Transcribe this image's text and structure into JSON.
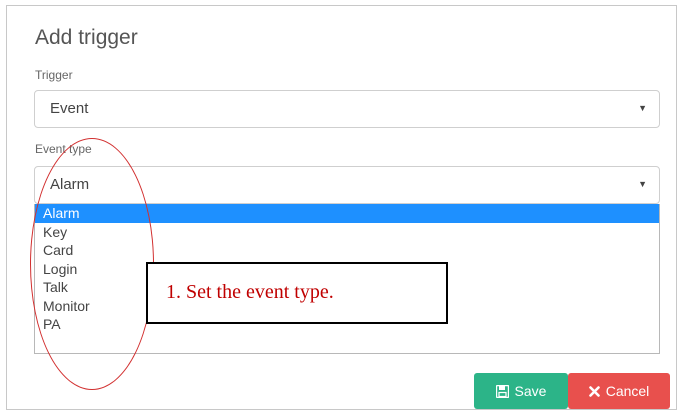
{
  "dialog": {
    "title": "Add trigger"
  },
  "trigger_field": {
    "label": "Trigger",
    "value": "Event"
  },
  "event_type_field": {
    "label": "Event type",
    "value": "Alarm",
    "options": [
      "Alarm",
      "Key",
      "Card",
      "Login",
      "Talk",
      "Monitor",
      "PA"
    ],
    "selected_index": 0
  },
  "annotation": {
    "text": "1. Set the event type."
  },
  "buttons": {
    "save_label": "Save",
    "cancel_label": "Cancel"
  },
  "colors": {
    "save": "#2cb488",
    "cancel": "#e8504d",
    "highlight": "#1e90ff",
    "annotation_text": "#c00000",
    "annotation_ellipse": "#d23030"
  },
  "icons": {
    "save": "floppy-disk-icon",
    "cancel": "x-icon",
    "select": "caret-down-icon"
  }
}
